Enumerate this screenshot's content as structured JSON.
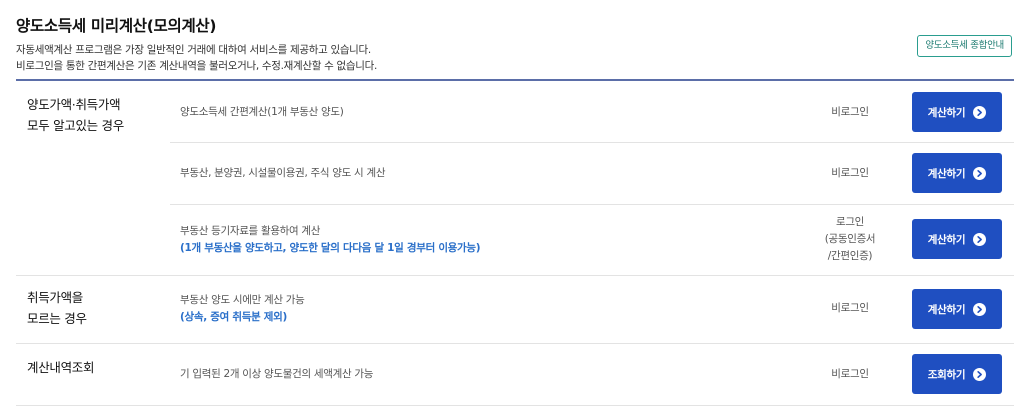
{
  "header": {
    "title": "양도소득세 미리계산(모의계산)",
    "desc_line1": "자동세액계산 프로그램은 가장 일반적인 거래에 대하여 서비스를 제공하고 있습니다.",
    "desc_line2": "비로그인을 통한 간편계산은 기존 계산내역을 불러오거나, 수정.재계산할 수 없습니다.",
    "guide_button": "양도소득세 종합안내"
  },
  "sections": [
    {
      "category_line1": "양도가액·취득가액",
      "category_line2": "모두 알고있는 경우",
      "items": [
        {
          "text": "양도소득세 간편계산(1개 부동산 양도)",
          "login": "비로그인",
          "button": "계산하기"
        },
        {
          "text": "부동산, 분양권, 시설물이용권, 주식 양도 시 계산",
          "login": "비로그인",
          "button": "계산하기"
        },
        {
          "text": "부동산 등기자료를 활용하여 계산",
          "note": "(1개 부동산을 양도하고, 양도한 달의 다다음 달 1일 경부터 이용가능)",
          "login_line1": "로그인",
          "login_line2": "(공동인증서",
          "login_line3": "/간편인증)",
          "button": "계산하기"
        }
      ]
    },
    {
      "category_line1": "취득가액을",
      "category_line2": "모르는 경우",
      "items": [
        {
          "text": "부동산 양도 시에만 계산 가능",
          "note": "(상속, 증여 취득분 제외)",
          "login": "비로그인",
          "button": "계산하기"
        }
      ]
    },
    {
      "category_line1": "계산내역조회",
      "items": [
        {
          "text": "기 입력된 2개 이상 양도물건의 세액계산 가능",
          "login": "비로그인",
          "button": "조회하기"
        }
      ]
    }
  ],
  "colors": {
    "accent": "#1f4fc1",
    "divider": "#5b6ea8",
    "note": "#2a6fc9",
    "guide": "#2a9d8f"
  },
  "icons": {
    "button_arrow": "chevron-right-circle-icon"
  }
}
